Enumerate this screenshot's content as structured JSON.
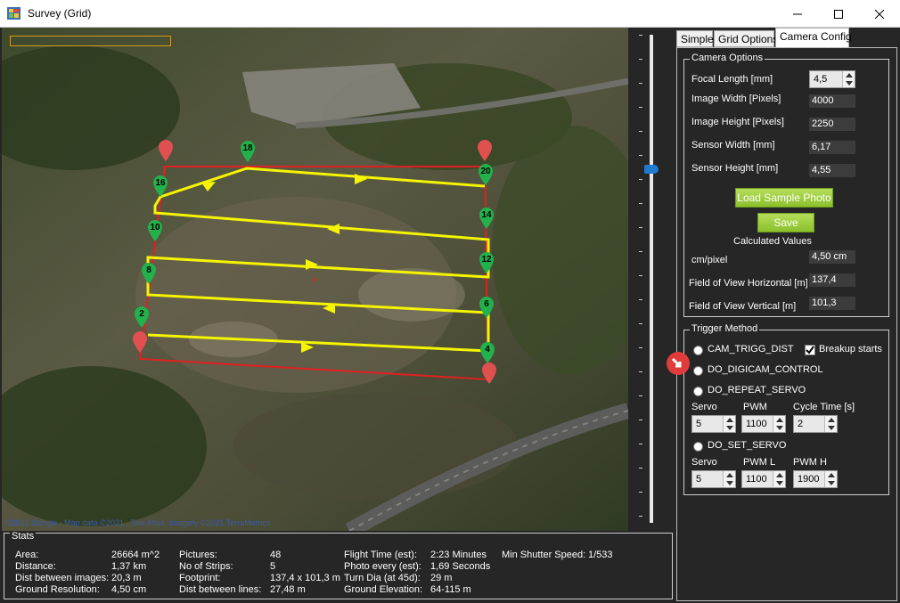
{
  "window": {
    "title": "Survey (Grid)",
    "minimize": "—",
    "maximize": "☐",
    "close": "✕"
  },
  "map": {
    "copyright": "©2021 Google - Map data ©2021 , Tele Atlas, Imagery ©2021 TerraMetrics",
    "waypoints": [
      {
        "label": "18"
      },
      {
        "label": "20"
      },
      {
        "label": "16"
      },
      {
        "label": "14"
      },
      {
        "label": "10"
      },
      {
        "label": "12"
      },
      {
        "label": "8"
      },
      {
        "label": "6"
      },
      {
        "label": "2"
      },
      {
        "label": "4"
      }
    ]
  },
  "stats": {
    "legend": "Stats",
    "col1": [
      {
        "label": "Area:",
        "value": "26664 m^2"
      },
      {
        "label": "Distance:",
        "value": "1,37 km"
      },
      {
        "label": "Dist between images:",
        "value": "20,3 m"
      },
      {
        "label": "Ground Resolution:",
        "value": "4,50 cm"
      }
    ],
    "col2": [
      {
        "label": "Pictures:",
        "value": "48"
      },
      {
        "label": "No of Strips:",
        "value": "5"
      },
      {
        "label": "Footprint:",
        "value": "137,4 x 101,3 m"
      },
      {
        "label": "Dist between lines:",
        "value": "27,48 m"
      }
    ],
    "col3": [
      {
        "label": "Flight Time (est):",
        "value": "2:23 Minutes"
      },
      {
        "label": "Photo every (est):",
        "value": "1,69 Seconds"
      },
      {
        "label": "Turn Dia (at 45d):",
        "value": "29 m"
      },
      {
        "label": "Ground Elevation:",
        "value": "64-115 m"
      }
    ],
    "col4": [
      {
        "label": "Min Shutter Speed:",
        "value": "1/533"
      }
    ]
  },
  "tabs": [
    {
      "label": "Simple"
    },
    {
      "label": "Grid Options"
    },
    {
      "label": "Camera Config"
    }
  ],
  "camera_options": {
    "legend": "Camera Options",
    "focal_length_label": "Focal Length [mm]",
    "focal_length_value": "4,5",
    "image_width_label": "Image Width [Pixels]",
    "image_width_value": "4000",
    "image_height_label": "Image Height [Pixels]",
    "image_height_value": "2250",
    "sensor_width_label": "Sensor Width [mm]",
    "sensor_width_value": "6,17",
    "sensor_height_label": "Sensor Height [mm]",
    "sensor_height_value": "4,55",
    "load_sample_label": "Load Sample Photo",
    "save_label": "Save",
    "calculated_label": "Calculated Values",
    "cm_pixel_label": "cm/pixel",
    "cm_pixel_value": "4,50 cm",
    "fov_h_label": "Field of View Horizontal [m]",
    "fov_h_value": "137,4",
    "fov_v_label": "Field of View Vertical [m]",
    "fov_v_value": "101,3"
  },
  "trigger": {
    "legend": "Trigger Method",
    "opt1": "CAM_TRIGG_DIST",
    "breakup_label": "Breakup starts",
    "opt2": "DO_DIGICAM_CONTROL",
    "opt3": "DO_REPEAT_SERVO",
    "servo_label": "Servo",
    "pwm_label": "PWM",
    "cycle_label": "Cycle Time [s]",
    "servo_value": "5",
    "pwm_value": "1100",
    "cycle_value": "2",
    "opt4": "DO_SET_SERVO",
    "servo2_label": "Servo",
    "pwml_label": "PWM L",
    "pwmh_label": "PWM H",
    "servo2_value": "5",
    "pwml_value": "1100",
    "pwmh_value": "1900"
  },
  "colors": {
    "boundary": "#e02020",
    "path": "#f5f500",
    "waypoint": "#22b14c",
    "accent_button": "#9acd32"
  }
}
